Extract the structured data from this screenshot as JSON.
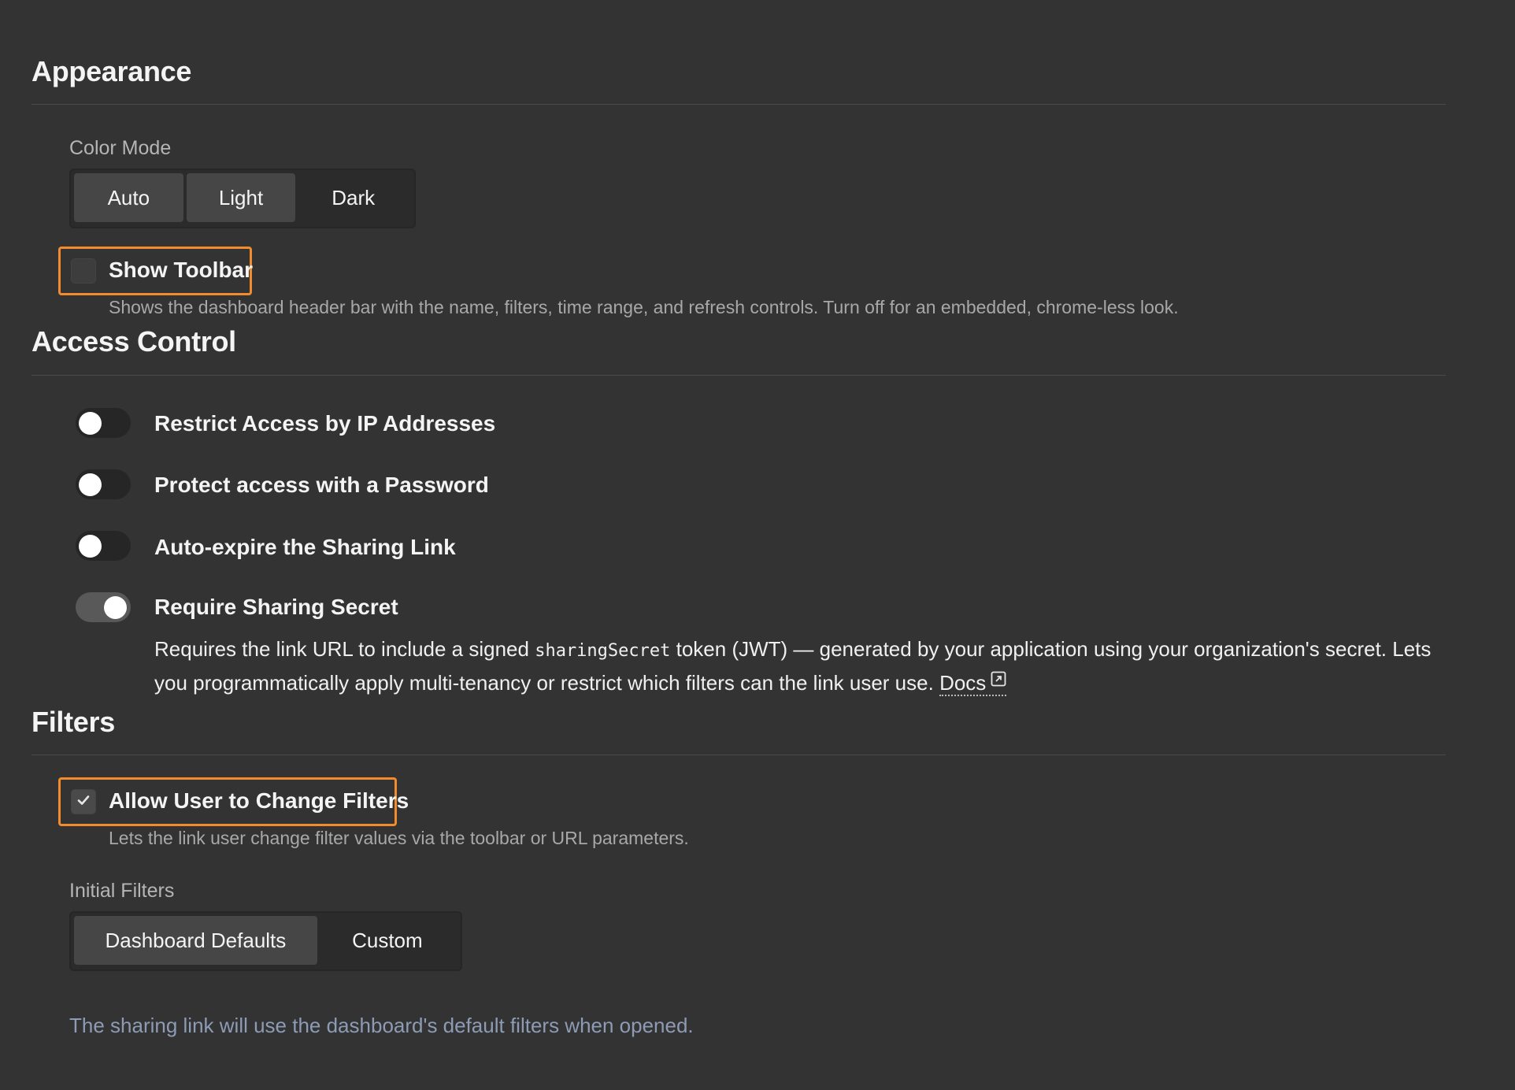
{
  "appearance": {
    "title": "Appearance",
    "color_mode": {
      "label": "Color Mode",
      "options": [
        "Auto",
        "Light",
        "Dark"
      ]
    },
    "show_toolbar": {
      "label": "Show Toolbar",
      "checked": false,
      "help": "Shows the dashboard header bar with the name, filters, time range, and refresh controls. Turn off for an embedded, chrome-less look."
    }
  },
  "access_control": {
    "title": "Access Control",
    "toggles": [
      {
        "label": "Restrict Access by IP Addresses",
        "on": false
      },
      {
        "label": "Protect access with a Password",
        "on": false
      },
      {
        "label": "Auto-expire the Sharing Link",
        "on": false
      },
      {
        "label": "Require Sharing Secret",
        "on": true
      }
    ],
    "secret_description": {
      "before": "Requires the link URL to include a signed ",
      "code": "sharingSecret",
      "after": " token (JWT) — generated by your application using your organization's secret. Lets you programmatically apply multi-tenancy or restrict which filters can the link user use. ",
      "link": "Docs"
    }
  },
  "filters": {
    "title": "Filters",
    "allow_change": {
      "label": "Allow User to Change Filters",
      "checked": true,
      "help": "Lets the link user change filter values via the toolbar or URL parameters."
    },
    "initial_filters": {
      "label": "Initial Filters",
      "options": [
        "Dashboard Defaults",
        "Custom"
      ]
    },
    "info": "The sharing link will use the dashboard's default filters when opened."
  },
  "colors": {
    "background": "#333333",
    "highlight": "#f28a2e",
    "info_text": "#8d9bb5"
  }
}
